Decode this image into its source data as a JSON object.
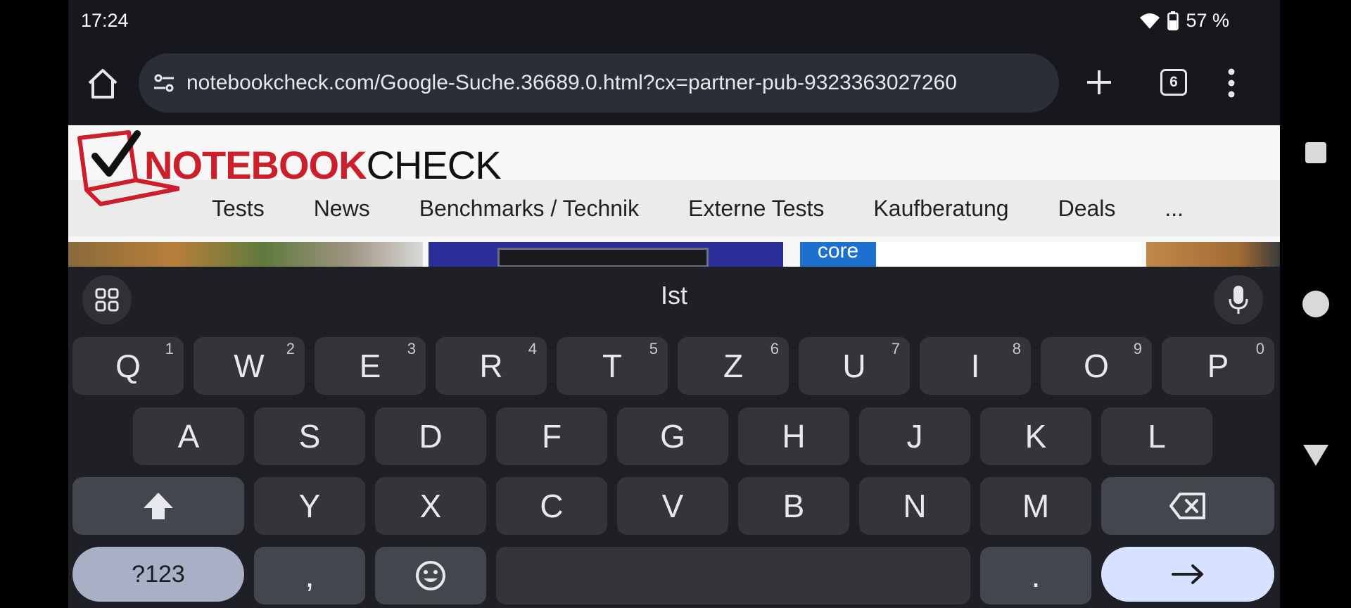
{
  "status": {
    "time": "17:24",
    "battery": "57 %"
  },
  "browser": {
    "url": "notebookcheck.com/Google-Suche.36689.0.html?cx=partner-pub-9323363027260",
    "tab_count": "6"
  },
  "site": {
    "logo_red": "NOTEBOOK",
    "logo_black": "CHECK",
    "nav": [
      "Tests",
      "News",
      "Benchmarks / Technik",
      "Externe Tests",
      "Kaufberatung",
      "Deals",
      "..."
    ]
  },
  "keyboard": {
    "suggestion": "Ist",
    "row1": [
      {
        "k": "Q",
        "h": "1"
      },
      {
        "k": "W",
        "h": "2"
      },
      {
        "k": "E",
        "h": "3"
      },
      {
        "k": "R",
        "h": "4"
      },
      {
        "k": "T",
        "h": "5"
      },
      {
        "k": "Z",
        "h": "6"
      },
      {
        "k": "U",
        "h": "7"
      },
      {
        "k": "I",
        "h": "8"
      },
      {
        "k": "O",
        "h": "9"
      },
      {
        "k": "P",
        "h": "0"
      }
    ],
    "row2": [
      "A",
      "S",
      "D",
      "F",
      "G",
      "H",
      "J",
      "K",
      "L"
    ],
    "row3": [
      "Y",
      "X",
      "C",
      "V",
      "B",
      "N",
      "M"
    ],
    "sym_label": "?123",
    "comma": ",",
    "period": "."
  },
  "colors": {
    "brand_red": "#cc1f2b",
    "enter_key": "#d6e2ff",
    "sym_key": "#a9b0c6"
  },
  "icons": [
    "home-icon",
    "tune-icon",
    "plus-icon",
    "tabs-icon",
    "more-vert-icon",
    "wifi-icon",
    "battery-icon",
    "apps-grid-icon",
    "mic-icon",
    "shift-icon",
    "backspace-icon",
    "emoji-icon",
    "arrow-right-icon",
    "square-icon",
    "circle-icon",
    "triangle-icon"
  ]
}
